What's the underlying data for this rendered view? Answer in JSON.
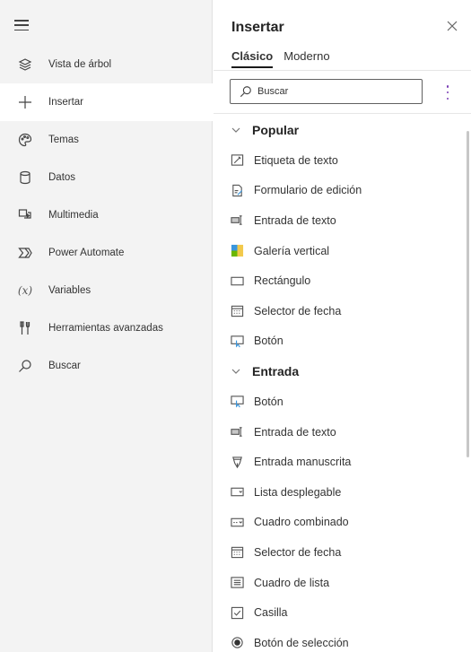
{
  "rail": {
    "items": [
      {
        "label": "Vista de árbol",
        "icon": "layers-icon"
      },
      {
        "label": "Insertar",
        "icon": "plus-icon"
      },
      {
        "label": "Temas",
        "icon": "palette-icon"
      },
      {
        "label": "Datos",
        "icon": "database-icon"
      },
      {
        "label": "Multimedia",
        "icon": "media-icon"
      },
      {
        "label": "Power Automate",
        "icon": "power-automate-icon"
      },
      {
        "label": "Variables",
        "icon": "variable-icon",
        "glyph": "(x)"
      },
      {
        "label": "Herramientas avanzadas",
        "icon": "tools-icon"
      },
      {
        "label": "Buscar",
        "icon": "search-icon"
      }
    ],
    "active_index": 1
  },
  "panel": {
    "title": "Insertar",
    "tabs": [
      {
        "label": "Clásico",
        "active": true
      },
      {
        "label": "Moderno",
        "active": false
      }
    ],
    "search": {
      "placeholder": "Buscar",
      "value": ""
    },
    "groups": [
      {
        "label": "Popular",
        "items": [
          {
            "label": "Etiqueta de texto",
            "icon": "label-icon"
          },
          {
            "label": "Formulario de edición",
            "icon": "form-icon"
          },
          {
            "label": "Entrada de texto",
            "icon": "text-input-icon"
          },
          {
            "label": "Galería vertical",
            "icon": "gallery-icon"
          },
          {
            "label": "Rectángulo",
            "icon": "rectangle-icon"
          },
          {
            "label": "Selector de fecha",
            "icon": "calendar-icon"
          },
          {
            "label": "Botón",
            "icon": "button-icon"
          }
        ]
      },
      {
        "label": "Entrada",
        "items": [
          {
            "label": "Botón",
            "icon": "button-icon"
          },
          {
            "label": "Entrada de texto",
            "icon": "text-input-icon"
          },
          {
            "label": "Entrada manuscrita",
            "icon": "pen-icon"
          },
          {
            "label": "Lista desplegable",
            "icon": "dropdown-icon"
          },
          {
            "label": "Cuadro combinado",
            "icon": "combobox-icon"
          },
          {
            "label": "Selector de fecha",
            "icon": "calendar-icon"
          },
          {
            "label": "Cuadro de lista",
            "icon": "listbox-icon"
          },
          {
            "label": "Casilla",
            "icon": "checkbox-icon"
          },
          {
            "label": "Botón de selección",
            "icon": "radio-icon"
          }
        ]
      }
    ]
  },
  "colors": {
    "accent": "#7b3fb5",
    "rail_bg": "#f3f3f3",
    "gallery_green": "#6bb700",
    "gallery_yellow": "#f2c94c",
    "gallery_blue": "#3a96dd"
  }
}
